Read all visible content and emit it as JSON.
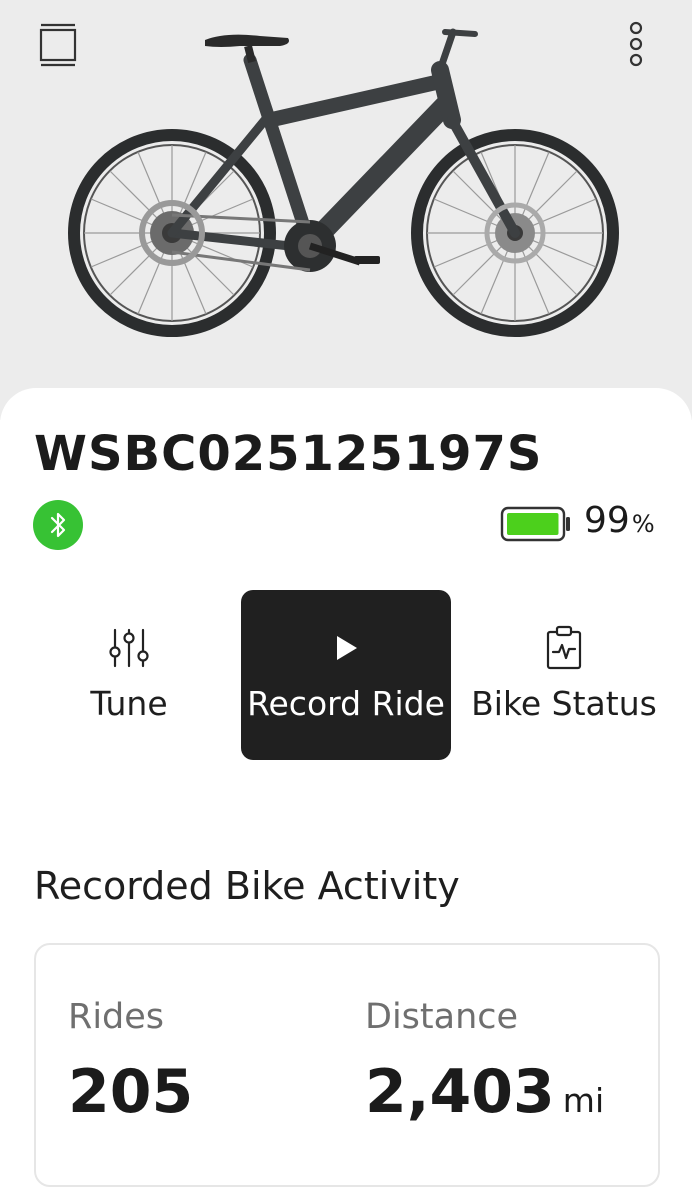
{
  "header": {
    "left_menu_icon": "panel-icon",
    "right_menu_icon": "vertical-dots-icon"
  },
  "bike": {
    "name": "WSBC025125197S",
    "connection_icon": "bluetooth-icon",
    "connection_color": "#37c234",
    "battery_percent": "99",
    "battery_unit": "%",
    "battery_fill_color": "#4cd01c"
  },
  "actions": [
    {
      "label": "Tune",
      "icon": "tune-sliders-icon"
    },
    {
      "label": "Record Ride",
      "icon": "play-icon"
    },
    {
      "label": "Bike Status",
      "icon": "clipboard-pulse-icon"
    }
  ],
  "activity": {
    "title": "Recorded Bike Activity",
    "rides_label": "Rides",
    "rides_value": "205",
    "distance_label": "Distance",
    "distance_value": "2,403",
    "distance_unit": "mi"
  }
}
